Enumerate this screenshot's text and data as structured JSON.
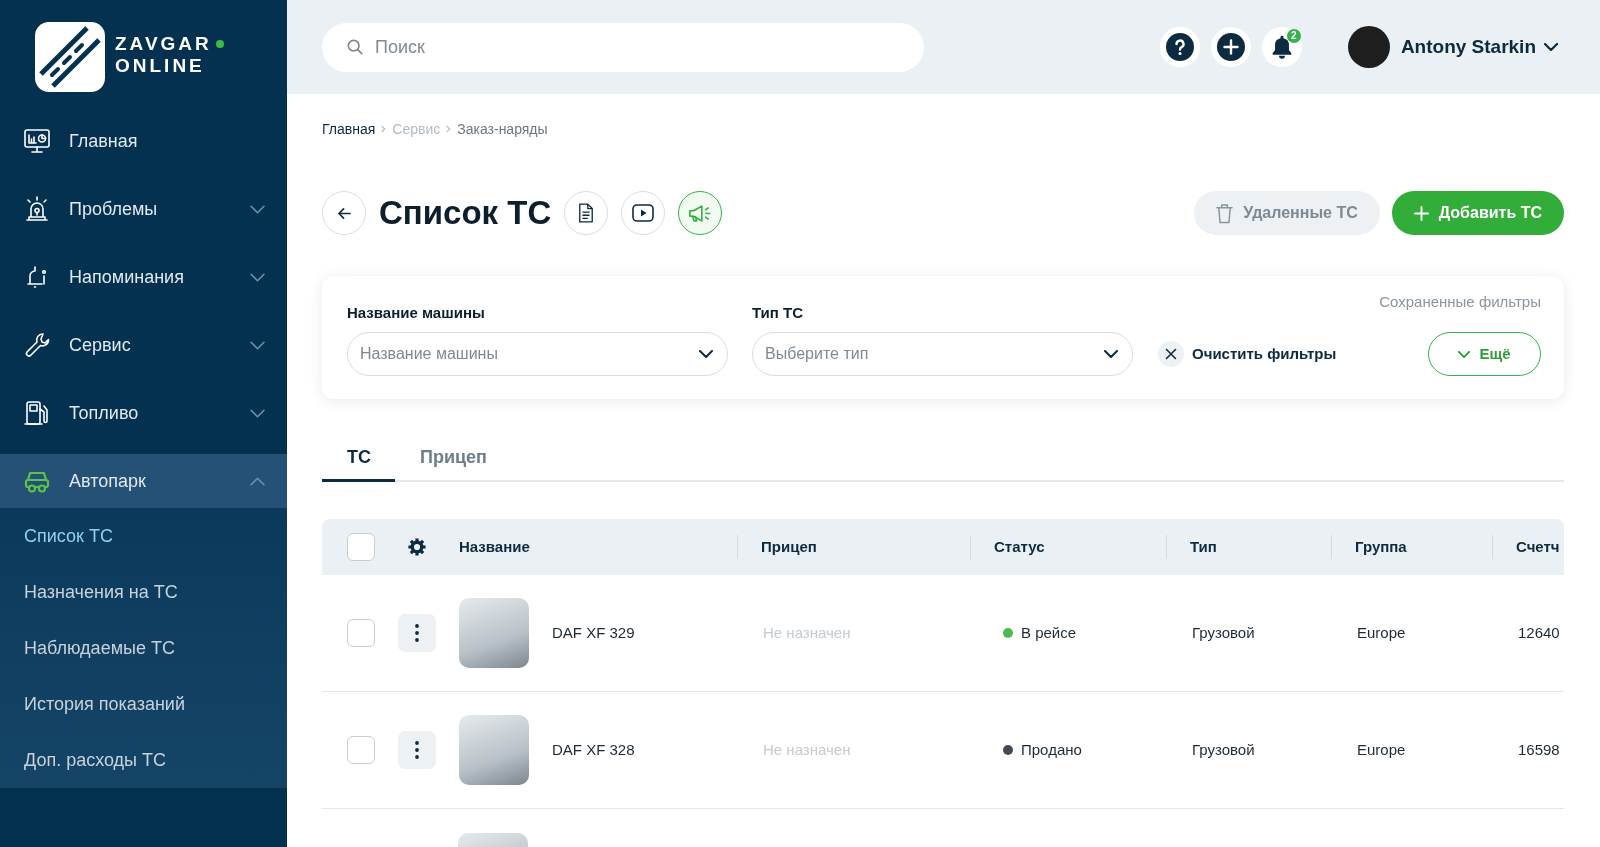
{
  "sidebar": {
    "logo": {
      "line_1": "ZAVGAR",
      "line_2": "ONLINE"
    },
    "items": [
      {
        "label": "Главная",
        "kind": "link",
        "selected": false
      },
      {
        "label": "Проблемы",
        "kind": "group",
        "selected": false,
        "expanded": false
      },
      {
        "label": "Напоминания",
        "kind": "group",
        "selected": false,
        "expanded": false
      },
      {
        "label": "Сервис",
        "kind": "group",
        "selected": false,
        "expanded": false
      },
      {
        "label": "Топливо",
        "kind": "group",
        "selected": false,
        "expanded": false
      },
      {
        "label": "Автопарк",
        "kind": "group",
        "selected": true,
        "expanded": true,
        "children": [
          {
            "label": "Список ТС",
            "selected": true
          },
          {
            "label": "Назначения на ТС",
            "selected": false
          },
          {
            "label": "Наблюдаемые ТС",
            "selected": false
          },
          {
            "label": "История показаний",
            "selected": false
          },
          {
            "label": "Доп. расходы ТС",
            "selected": false
          }
        ]
      }
    ]
  },
  "topbar": {
    "search": {
      "placeholder": "Поиск"
    },
    "notifications": {
      "count": "2"
    },
    "user": {
      "name": "Antony Starkin"
    }
  },
  "breadcrumb": [
    {
      "label": "Главная",
      "disabled": false
    },
    {
      "label": "Сервис",
      "disabled": true
    },
    {
      "label": "Заказ-наряды",
      "disabled": false
    }
  ],
  "page": {
    "title": "Список ТС",
    "buttons": [
      {
        "label": "Удаленные ТС",
        "kind": "secondary"
      },
      {
        "label": "Добавить ТС",
        "kind": "primary"
      }
    ]
  },
  "filters": {
    "fields": [
      {
        "label": "Название машины",
        "placeholder": "Название машины"
      },
      {
        "label": "Тип ТС",
        "placeholder": "Выберите тип"
      }
    ],
    "clear": "Очистить фильтры",
    "saved": "Сохраненные фильтры",
    "more": "Ещё"
  },
  "tabs": [
    {
      "label": "ТС",
      "selected": true
    },
    {
      "label": "Прицеп",
      "selected": false
    }
  ],
  "table": {
    "select_all": {
      "checked": false
    },
    "columns": [
      "Название",
      "Прицеп",
      "Статус",
      "Тип",
      "Группа",
      "Счетч"
    ],
    "rows": [
      {
        "checked": false,
        "name": "DAF XF 329",
        "trailer": "Не назначен",
        "status": {
          "label": "В рейсе",
          "color": "#4cbb4f"
        },
        "type": "Грузовой",
        "group": "Europe",
        "column_6": "12640"
      },
      {
        "checked": false,
        "name": "DAF XF 328",
        "trailer": "Не назначен",
        "status": {
          "label": "Продано",
          "color": "#424b53"
        },
        "type": "Грузовой",
        "group": "Europe",
        "column_6": "16598"
      },
      {}
    ]
  }
}
